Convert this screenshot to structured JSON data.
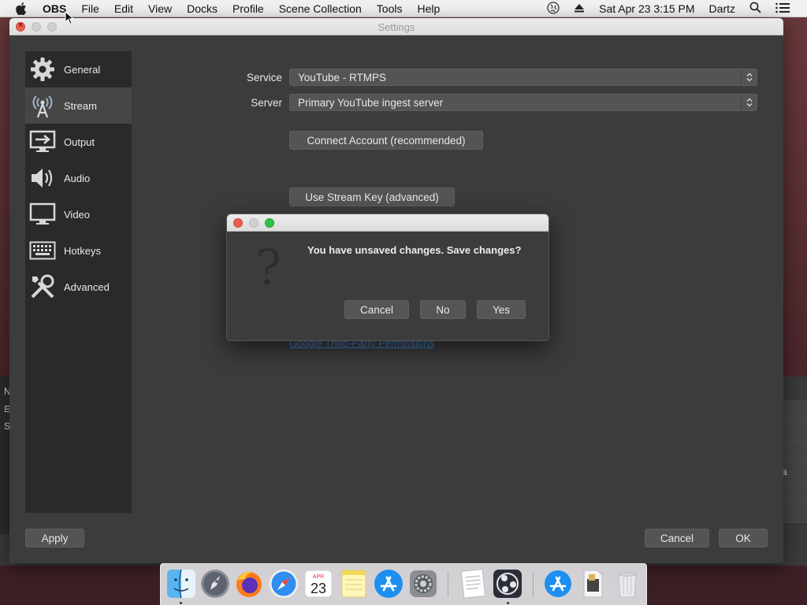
{
  "menubar": {
    "app_name": "OBS",
    "items": [
      "File",
      "Edit",
      "View",
      "Docks",
      "Profile",
      "Scene Collection",
      "Tools",
      "Help"
    ],
    "clock": "Sat Apr 23  3:15 PM",
    "user": "Dartz"
  },
  "settings": {
    "title": "Settings",
    "sidebar": [
      {
        "label": "General",
        "icon": "gear-icon"
      },
      {
        "label": "Stream",
        "icon": "antenna-icon"
      },
      {
        "label": "Output",
        "icon": "output-monitor-icon"
      },
      {
        "label": "Audio",
        "icon": "speaker-icon"
      },
      {
        "label": "Video",
        "icon": "monitor-icon"
      },
      {
        "label": "Hotkeys",
        "icon": "keyboard-icon"
      },
      {
        "label": "Advanced",
        "icon": "tools-icon"
      }
    ],
    "active_item": "Stream",
    "service_label": "Service",
    "service_value": "YouTube - RTMPS",
    "server_label": "Server",
    "server_value": "Primary YouTube ingest server",
    "connect_button": "Connect Account (recommended)",
    "stream_key_button": "Use Stream Key (advanced)",
    "permissions_link": "Google Third-Party Permissions",
    "apply_button": "Apply",
    "cancel_button": "Cancel",
    "ok_button": "OK"
  },
  "dialog": {
    "message": "You have unsaved changes. Save changes?",
    "cancel": "Cancel",
    "no": "No",
    "yes": "Yes"
  },
  "dock": {
    "apps": [
      "Finder",
      "Launchpad",
      "Firefox",
      "Safari",
      "Calendar",
      "Notes",
      "App Store",
      "System Preferences",
      "TextEdit",
      "OBS",
      "App Store Downloads",
      "Preview",
      "Trash"
    ],
    "calendar_month": "APR",
    "calendar_day": "23"
  },
  "colors": {
    "accent_link": "#3c86d6",
    "window_bg": "#3c3c3c",
    "sidebar_bg": "#2a2a2a"
  }
}
